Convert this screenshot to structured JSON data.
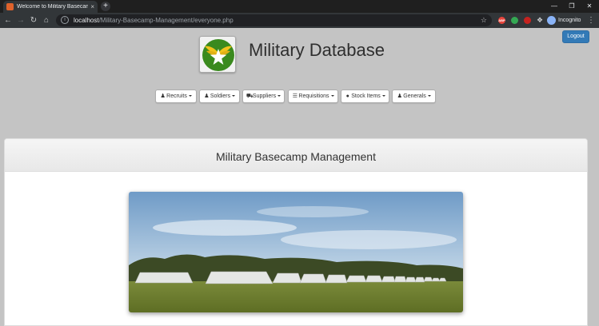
{
  "browser": {
    "tab_title": "Welcome to Military Basecamp M",
    "tab_close": "×",
    "new_tab": "+",
    "url_host": "localhost",
    "url_path": "/Military-Basecamp-Management/everyone.php",
    "profile_label": "Incognito",
    "ext_abp": "ABP"
  },
  "header": {
    "logout_label": "Logout",
    "site_title": "Military Database"
  },
  "nav": {
    "recruits": "Recruits",
    "soldiers": "Soldiers",
    "suppliers": "Suppliers",
    "requisitions": "Requisitions",
    "stock_items": "Stock Items",
    "generals": "Generals"
  },
  "panel": {
    "heading": "Military Basecamp Management"
  },
  "colors": {
    "accent": "#337ab7",
    "page_bg": "#c4c4c4",
    "logo_green": "#3a8a1e",
    "logo_gold": "#f2c21b"
  }
}
